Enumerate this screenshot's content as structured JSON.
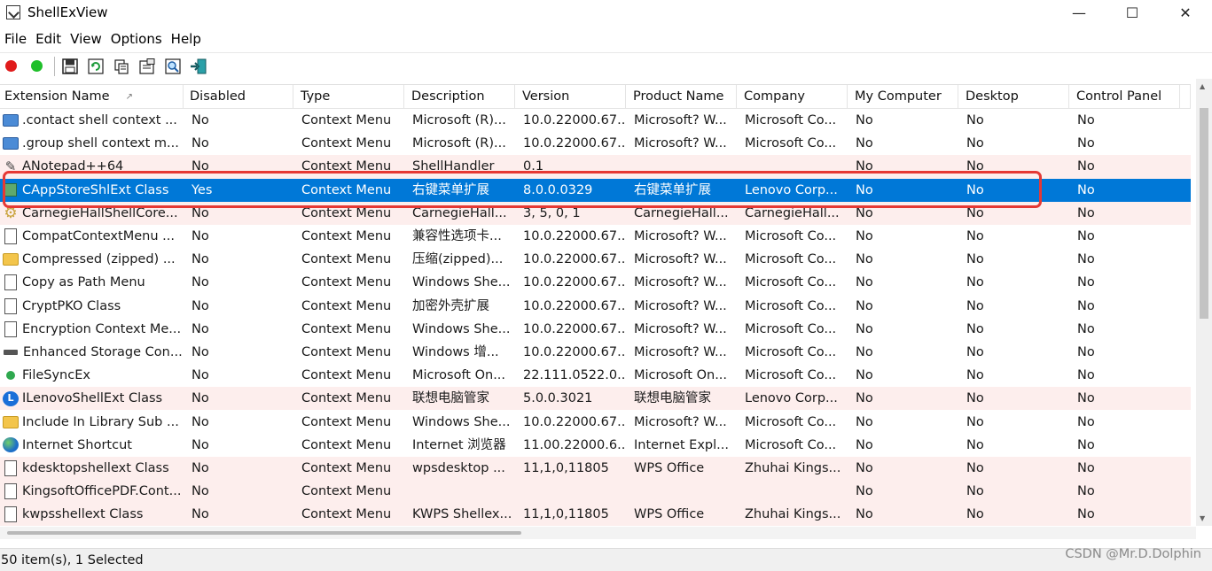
{
  "window": {
    "title": "ShellExView",
    "minimize": "—",
    "maximize": "☐",
    "close": "✕"
  },
  "menu": [
    "File",
    "Edit",
    "View",
    "Options",
    "Help"
  ],
  "toolbar": {
    "buttons": [
      "disable-red",
      "enable-green",
      "save",
      "refresh",
      "copy",
      "properties",
      "find",
      "exit"
    ]
  },
  "columns": [
    "Extension Name",
    "Disabled",
    "Type",
    "Description",
    "Version",
    "Product Name",
    "Company",
    "My Computer",
    "Desktop",
    "Control Panel"
  ],
  "sort_indicator": "↗",
  "rows": [
    {
      "icon": "blue",
      "name": ".contact shell context ...",
      "disabled": "No",
      "type": "Context Menu",
      "desc": "Microsoft (R)...",
      "version": "10.0.22000.67...",
      "product": "Microsoft? W...",
      "company": "Microsoft Co...",
      "mycomp": "No",
      "desktop": "No",
      "cpanel": "No",
      "state": "normal"
    },
    {
      "icon": "blue",
      "name": ".group shell context m...",
      "disabled": "No",
      "type": "Context Menu",
      "desc": "Microsoft (R)...",
      "version": "10.0.22000.67...",
      "product": "Microsoft? W...",
      "company": "Microsoft Co...",
      "mycomp": "No",
      "desktop": "No",
      "cpanel": "No",
      "state": "normal"
    },
    {
      "icon": "pen",
      "name": "ANotepad++64",
      "disabled": "No",
      "type": "Context Menu",
      "desc": "ShellHandler",
      "version": "0.1",
      "product": "",
      "company": "",
      "mycomp": "No",
      "desktop": "No",
      "cpanel": "No",
      "state": "pink"
    },
    {
      "icon": "app",
      "name": "CAppStoreShlExt Class",
      "disabled": "Yes",
      "type": "Context Menu",
      "desc": "右键菜单扩展",
      "version": "8.0.0.0329",
      "product": "右键菜单扩展",
      "company": "Lenovo Corp...",
      "mycomp": "No",
      "desktop": "No",
      "cpanel": "No",
      "state": "sel"
    },
    {
      "icon": "gear",
      "name": "CarnegieHallShellCore...",
      "disabled": "No",
      "type": "Context Menu",
      "desc": "CarnegieHall...",
      "version": "3, 5, 0, 1",
      "product": "CarnegieHall...",
      "company": "CarnegieHall...",
      "mycomp": "No",
      "desktop": "No",
      "cpanel": "No",
      "state": "pink"
    },
    {
      "icon": "doc",
      "name": "CompatContextMenu ...",
      "disabled": "No",
      "type": "Context Menu",
      "desc": "兼容性选项卡...",
      "version": "10.0.22000.67...",
      "product": "Microsoft? W...",
      "company": "Microsoft Co...",
      "mycomp": "No",
      "desktop": "No",
      "cpanel": "No",
      "state": "normal"
    },
    {
      "icon": "folder",
      "name": "Compressed (zipped) ...",
      "disabled": "No",
      "type": "Context Menu",
      "desc": "压缩(zipped)...",
      "version": "10.0.22000.67...",
      "product": "Microsoft? W...",
      "company": "Microsoft Co...",
      "mycomp": "No",
      "desktop": "No",
      "cpanel": "No",
      "state": "normal"
    },
    {
      "icon": "doc",
      "name": "Copy as Path Menu",
      "disabled": "No",
      "type": "Context Menu",
      "desc": "Windows She...",
      "version": "10.0.22000.67...",
      "product": "Microsoft? W...",
      "company": "Microsoft Co...",
      "mycomp": "No",
      "desktop": "No",
      "cpanel": "No",
      "state": "normal"
    },
    {
      "icon": "doc",
      "name": "CryptPKO Class",
      "disabled": "No",
      "type": "Context Menu",
      "desc": "加密外壳扩展",
      "version": "10.0.22000.67...",
      "product": "Microsoft? W...",
      "company": "Microsoft Co...",
      "mycomp": "No",
      "desktop": "No",
      "cpanel": "No",
      "state": "normal"
    },
    {
      "icon": "doc",
      "name": "Encryption Context Me...",
      "disabled": "No",
      "type": "Context Menu",
      "desc": "Windows She...",
      "version": "10.0.22000.67...",
      "product": "Microsoft? W...",
      "company": "Microsoft Co...",
      "mycomp": "No",
      "desktop": "No",
      "cpanel": "No",
      "state": "normal"
    },
    {
      "icon": "drive",
      "name": "Enhanced Storage Con...",
      "disabled": "No",
      "type": "Context Menu",
      "desc": "Windows 增...",
      "version": "10.0.22000.67...",
      "product": "Microsoft? W...",
      "company": "Microsoft Co...",
      "mycomp": "No",
      "desktop": "No",
      "cpanel": "No",
      "state": "normal"
    },
    {
      "icon": "green",
      "name": "FileSyncEx",
      "disabled": "No",
      "type": "Context Menu",
      "desc": "Microsoft On...",
      "version": "22.111.0522.0...",
      "product": "Microsoft On...",
      "company": "Microsoft Co...",
      "mycomp": "No",
      "desktop": "No",
      "cpanel": "No",
      "state": "normal"
    },
    {
      "icon": "lenovo",
      "name": "ILenovoShellExt Class",
      "disabled": "No",
      "type": "Context Menu",
      "desc": "联想电脑管家",
      "version": "5.0.0.3021",
      "product": "联想电脑管家",
      "company": "Lenovo Corp...",
      "mycomp": "No",
      "desktop": "No",
      "cpanel": "No",
      "state": "pink"
    },
    {
      "icon": "folder",
      "name": "Include In Library Sub ...",
      "disabled": "No",
      "type": "Context Menu",
      "desc": "Windows She...",
      "version": "10.0.22000.67...",
      "product": "Microsoft? W...",
      "company": "Microsoft Co...",
      "mycomp": "No",
      "desktop": "No",
      "cpanel": "No",
      "state": "normal"
    },
    {
      "icon": "globe",
      "name": "Internet Shortcut",
      "disabled": "No",
      "type": "Context Menu",
      "desc": "Internet 浏览器",
      "version": "11.00.22000.6...",
      "product": "Internet Expl...",
      "company": "Microsoft Co...",
      "mycomp": "No",
      "desktop": "No",
      "cpanel": "No",
      "state": "normal"
    },
    {
      "icon": "doc",
      "name": "kdesktopshellext Class",
      "disabled": "No",
      "type": "Context Menu",
      "desc": "wpsdesktop ...",
      "version": "11,1,0,11805",
      "product": "WPS Office",
      "company": "Zhuhai Kings...",
      "mycomp": "No",
      "desktop": "No",
      "cpanel": "No",
      "state": "pink"
    },
    {
      "icon": "doc",
      "name": "KingsoftOfficePDF.Cont...",
      "disabled": "No",
      "type": "Context Menu",
      "desc": "",
      "version": "",
      "product": "",
      "company": "",
      "mycomp": "No",
      "desktop": "No",
      "cpanel": "No",
      "state": "pink"
    },
    {
      "icon": "doc",
      "name": "kwpsshellext Class",
      "disabled": "No",
      "type": "Context Menu",
      "desc": "KWPS Shellex...",
      "version": "11,1,0,11805",
      "product": "WPS Office",
      "company": "Zhuhai Kings...",
      "mycomp": "No",
      "desktop": "No",
      "cpanel": "No",
      "state": "pink"
    }
  ],
  "status": {
    "text": "50 item(s), 1 Selected"
  },
  "watermark": "CSDN @Mr.D.Dolphin",
  "colors": {
    "selection": "#0078d7",
    "highlight_row": "#fdeeed",
    "annotation": "#e53935"
  }
}
